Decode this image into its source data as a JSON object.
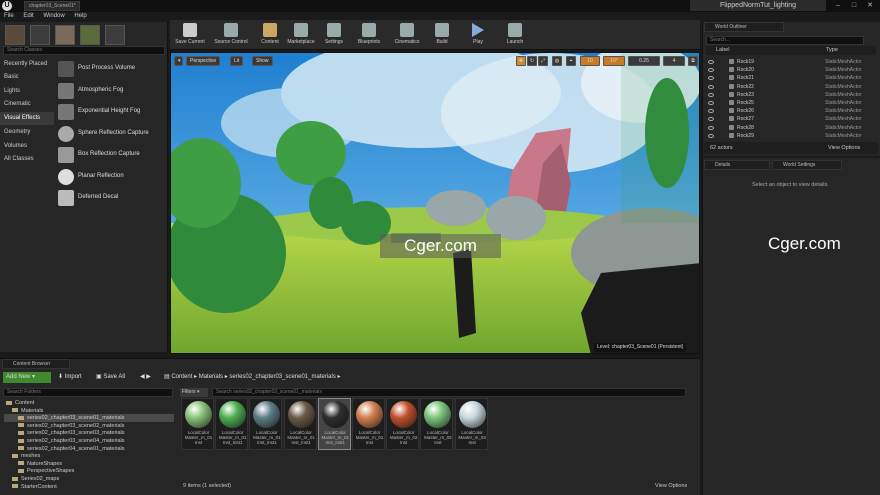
{
  "title_bar": {
    "doc_tab": "chapter03_Scene01*",
    "project": "FlippedNormTut_lighting"
  },
  "menu": [
    "File",
    "Edit",
    "Window",
    "Help"
  ],
  "modes": {
    "search_placeholder": "Search Classes",
    "categories": [
      "Recently Placed",
      "Basic",
      "Lights",
      "Cinematic",
      "Visual Effects",
      "Geometry",
      "Volumes",
      "All Classes"
    ],
    "active_category": "Visual Effects",
    "items": [
      "Post Process Volume",
      "Atmospheric Fog",
      "Exponential Height Fog",
      "Sphere Reflection Capture",
      "Box Reflection Capture",
      "Planar Reflection",
      "Deferred Decal"
    ]
  },
  "toolbar": [
    "Save Current",
    "Source Control",
    "Content",
    "Marketplace",
    "Settings",
    "Blueprints",
    "Cinematics",
    "Build",
    "Play",
    "Launch"
  ],
  "viewport": {
    "perspective": "Perspective",
    "lit": "Lit",
    "show": "Show",
    "grid_snap": "10",
    "rot_snap": "10°",
    "scale_snap": "0.25",
    "cam_speed": "4",
    "level_label": "Level: chapter03_Scene01 (Persistent)",
    "watermark": "Cger.com"
  },
  "outliner": {
    "tab": "World Outliner",
    "search_placeholder": "Search...",
    "col_label": "Label",
    "col_type": "Type",
    "rows": [
      {
        "name": "Rock19",
        "type": "StaticMeshActor"
      },
      {
        "name": "Rock20",
        "type": "StaticMeshActor"
      },
      {
        "name": "Rock21",
        "type": "StaticMeshActor"
      },
      {
        "name": "Rock22",
        "type": "StaticMeshActor"
      },
      {
        "name": "Rock23",
        "type": "StaticMeshActor"
      },
      {
        "name": "Rock25",
        "type": "StaticMeshActor"
      },
      {
        "name": "Rock26",
        "type": "StaticMeshActor"
      },
      {
        "name": "Rock27",
        "type": "StaticMeshActor"
      },
      {
        "name": "Rock28",
        "type": "StaticMeshActor"
      },
      {
        "name": "Rock29",
        "type": "StaticMeshActor"
      }
    ],
    "count": "62 actors",
    "view_options": "View Options"
  },
  "details": {
    "tab": "Details",
    "tab2": "World Settings",
    "empty": "Select an object to view details.",
    "watermark": "Cger.com"
  },
  "content_browser": {
    "tab": "Content Browser",
    "add_new": "Add New",
    "import": "Import",
    "save_all": "Save All",
    "path": [
      "Content",
      "Materials",
      "series02_chapter03_scene01_materials"
    ],
    "search_folders": "Search Folders",
    "filters": "Filters",
    "search_assets": "Search series02_chapter03_scene01_materials",
    "tree": [
      {
        "label": "Content",
        "indent": 0,
        "sel": false
      },
      {
        "label": "Materials",
        "indent": 1,
        "sel": false
      },
      {
        "label": "series02_chapter03_scene01_materials",
        "indent": 2,
        "sel": true
      },
      {
        "label": "series02_chapter03_scene02_materials",
        "indent": 2,
        "sel": false
      },
      {
        "label": "series02_chapter03_scene03_materials",
        "indent": 2,
        "sel": false
      },
      {
        "label": "series02_chapter03_scene04_materials",
        "indent": 2,
        "sel": false
      },
      {
        "label": "series02_chapter04_scene01_materials",
        "indent": 2,
        "sel": false
      },
      {
        "label": "meshes",
        "indent": 1,
        "sel": false
      },
      {
        "label": "NatureShapes",
        "indent": 2,
        "sel": false
      },
      {
        "label": "PerspectiveShapes",
        "indent": 2,
        "sel": false
      },
      {
        "label": "Series02_maps",
        "indent": 1,
        "sel": false
      },
      {
        "label": "StarterContent",
        "indent": 1,
        "sel": false
      }
    ],
    "assets": [
      {
        "label": "LocalColor Master_m_01 Inst",
        "color": "#8bc47a"
      },
      {
        "label": "LocalColor Master_m_01 Inst_Inst1",
        "color": "#4fae52"
      },
      {
        "label": "LocalColor Master_m_01 Inst_Inst1",
        "color": "#5e7d86"
      },
      {
        "label": "LocalColor Master_m_01 Inst_Inst1",
        "color": "#6b5a47"
      },
      {
        "label": "LocalColor Master_m_01 Inst_Inst1",
        "color": "#2e2e2e"
      },
      {
        "label": "LocalColor Master_m_01 Inst",
        "color": "#d27f4e"
      },
      {
        "label": "LocalColor Master_m_02 Inst",
        "color": "#c2502c"
      },
      {
        "label": "LocalColor Master_m_02 Inst",
        "color": "#7cc57a"
      },
      {
        "label": "LocalColor Master_m_03 Inst",
        "color": "#c9d8dd"
      }
    ],
    "selected_asset": 4,
    "status": "9 items (1 selected)",
    "view_options": "View Options"
  }
}
